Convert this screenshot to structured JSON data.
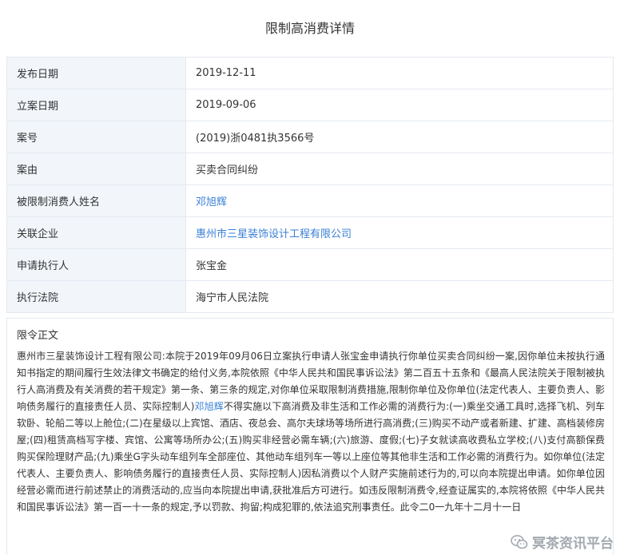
{
  "page_title": "限制高消费详情",
  "fields": [
    {
      "label": "发布日期",
      "value": "2019-12-11"
    },
    {
      "label": "立案日期",
      "value": "2019-09-06"
    },
    {
      "label": "案号",
      "value": "(2019)浙0481执3566号"
    },
    {
      "label": "案由",
      "value": "买卖合同纠纷"
    },
    {
      "label": "被限制消费人姓名",
      "value": "邓旭辉"
    },
    {
      "label": "关联企业",
      "value": "惠州市三星装饰设计工程有限公司"
    },
    {
      "label": "申请执行人",
      "value": "张宝金"
    },
    {
      "label": "执行法院",
      "value": "海宁市人民法院"
    }
  ],
  "notice": {
    "label": "限令正文",
    "company": "惠州市三星装饰设计工程有限公司",
    "text_1": ":本院于2019年09月06日立案执行申请人张宝金申请执行你单位买卖合同纠纷一案,因你单位未按执行通知书指定的期间履行生效法律文书确定的给付义务,本院依照《中华人民共和国民事诉讼法》第二百五十五条和《最高人民法院关于限制被执行人高消费及有关消费的若干规定》第一条、第三条的规定,对你单位采取限制消费措施,限制你单位及你单位(法定代表人、主要负责人、影响债务履行的直接责任人员、实际控制人)",
    "person": "邓旭辉",
    "text_2": "不得实施以下高消费及非生活和工作必需的消费行为:(一)乘坐交通工具时,选择飞机、列车软卧、轮船二等以上舱位;(二)在星级以上宾馆、酒店、夜总会、高尔夫球场等场所进行高消费;(三)购买不动产或者新建、扩建、高档装修房屋;(四)租赁高档写字楼、宾馆、公寓等场所办公;(五)购买非经营必需车辆;(六)旅游、度假;(七)子女就读高收费私立学校;(八)支付高额保费购买保险理财产品;(九)乘坐G字头动车组列车全部座位、其他动车组列车一等以上座位等其他非生活和工作必需的消费行为。如你单位(法定代表人、主要负责人、影响债务履行的直接责任人员、实际控制人)因私消费以个人财产实施前述行为的,可以向本院提出申请。如你单位因经营必需而进行前述禁止的消费活动的,应当向本院提出申请,获批准后方可进行。如违反限制消费令,经查证属实的,本院将依照《中华人民共和国民事诉讼法》第一百一十一条的规定,予以罚款、拘留;构成犯罪的,依法追究刑事责任。此令二0一九年十二月十一日"
  },
  "watermark": {
    "text": "冥茶资讯平台",
    "icon": "wechat-icon"
  },
  "colors": {
    "label_bg": "#f2f6fb",
    "border": "#e4e9f1",
    "link": "#3a7fd5"
  }
}
